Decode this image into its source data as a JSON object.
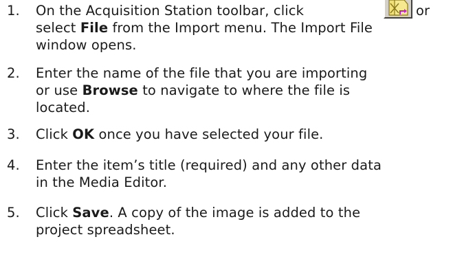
{
  "steps": [
    {
      "num": "1.",
      "line1_before": "On the Acquisition Station toolbar, click",
      "line1_after": "or",
      "line2_before": "select ",
      "line2_bold": "File",
      "line2_after": " from the Import menu. The Import File",
      "line3": "window opens.",
      "toolbar_icon": "import-file-icon"
    },
    {
      "num": "2.",
      "line1": "Enter the name of the file that you are importing",
      "line2_before": "or use ",
      "line2_bold": "Browse",
      "line2_after": " to navigate to where the file is",
      "line3": "located."
    },
    {
      "num": "3.",
      "line1_before": "Click ",
      "line1_bold": "OK",
      "line1_after": " once you have selected your file."
    },
    {
      "num": "4.",
      "line1": "Enter the item’s title (required) and any other data",
      "line2": "in the Media Editor."
    },
    {
      "num": "5.",
      "line1_before": "Click ",
      "line1_bold": "Save",
      "line1_after": ". A copy of the image is added to the",
      "line2": "project spreadsheet."
    }
  ],
  "colors": {
    "text": "#1a1a1a",
    "button_face": "#d4d0c8",
    "icon_fill": "#f2e07a",
    "icon_stroke": "#8a7a1e",
    "icon_accent": "#c020c0"
  }
}
